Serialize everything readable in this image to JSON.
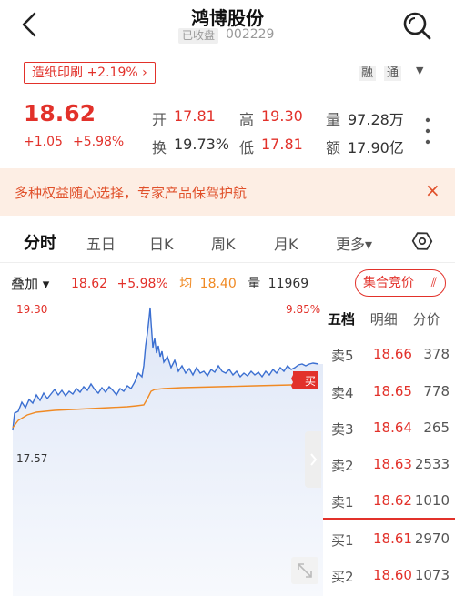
{
  "header": {
    "title": "鸿博股份",
    "status": "已收盘",
    "code": "002229"
  },
  "sector": {
    "label": "造纸印刷 +2.19%  ›"
  },
  "badges": {
    "rong": "融",
    "tong": "通",
    "dropdown": "▼"
  },
  "quote": {
    "price": "18.62",
    "change": "+1.05",
    "change_pct": "+5.98%",
    "open_label": "开",
    "open": "17.81",
    "high_label": "高",
    "high": "19.30",
    "volume_label": "量",
    "volume": "97.28万",
    "turnover_label": "换",
    "turnover": "19.73%",
    "low_label": "低",
    "low": "17.81",
    "amount_label": "额",
    "amount": "17.90亿"
  },
  "banner": {
    "text": "多种权益随心选择，专家产品保驾护航",
    "close": "×"
  },
  "tabs": [
    {
      "label": "分时"
    },
    {
      "label": "五日"
    },
    {
      "label": "日K"
    },
    {
      "label": "周K"
    },
    {
      "label": "月K"
    },
    {
      "label": "更多▾"
    }
  ],
  "info": {
    "overlay": "叠加 ▾",
    "price": "18.62",
    "pct": "+5.98%",
    "avg_label": "均",
    "avg": "18.40",
    "vol_label": "量",
    "vol": "11969",
    "auction": "集合竞价"
  },
  "chart_labels": {
    "top_left": "19.30",
    "top_right": "9.85%",
    "mid_left": "17.57",
    "marker": "买"
  },
  "order_book": {
    "tabs": [
      "五档",
      "明细",
      "分价"
    ],
    "asks": [
      {
        "label": "卖5",
        "price": "18.66",
        "vol": "378"
      },
      {
        "label": "卖4",
        "price": "18.65",
        "vol": "778"
      },
      {
        "label": "卖3",
        "price": "18.64",
        "vol": "265"
      },
      {
        "label": "卖2",
        "price": "18.63",
        "vol": "2533"
      },
      {
        "label": "卖1",
        "price": "18.62",
        "vol": "1010"
      }
    ],
    "bids": [
      {
        "label": "买1",
        "price": "18.61",
        "vol": "2970"
      },
      {
        "label": "买2",
        "price": "18.60",
        "vol": "1073"
      }
    ]
  },
  "colors": {
    "up": "#e2312a",
    "avg_line": "#f08a24",
    "price_line": "#3b6fd1"
  }
}
